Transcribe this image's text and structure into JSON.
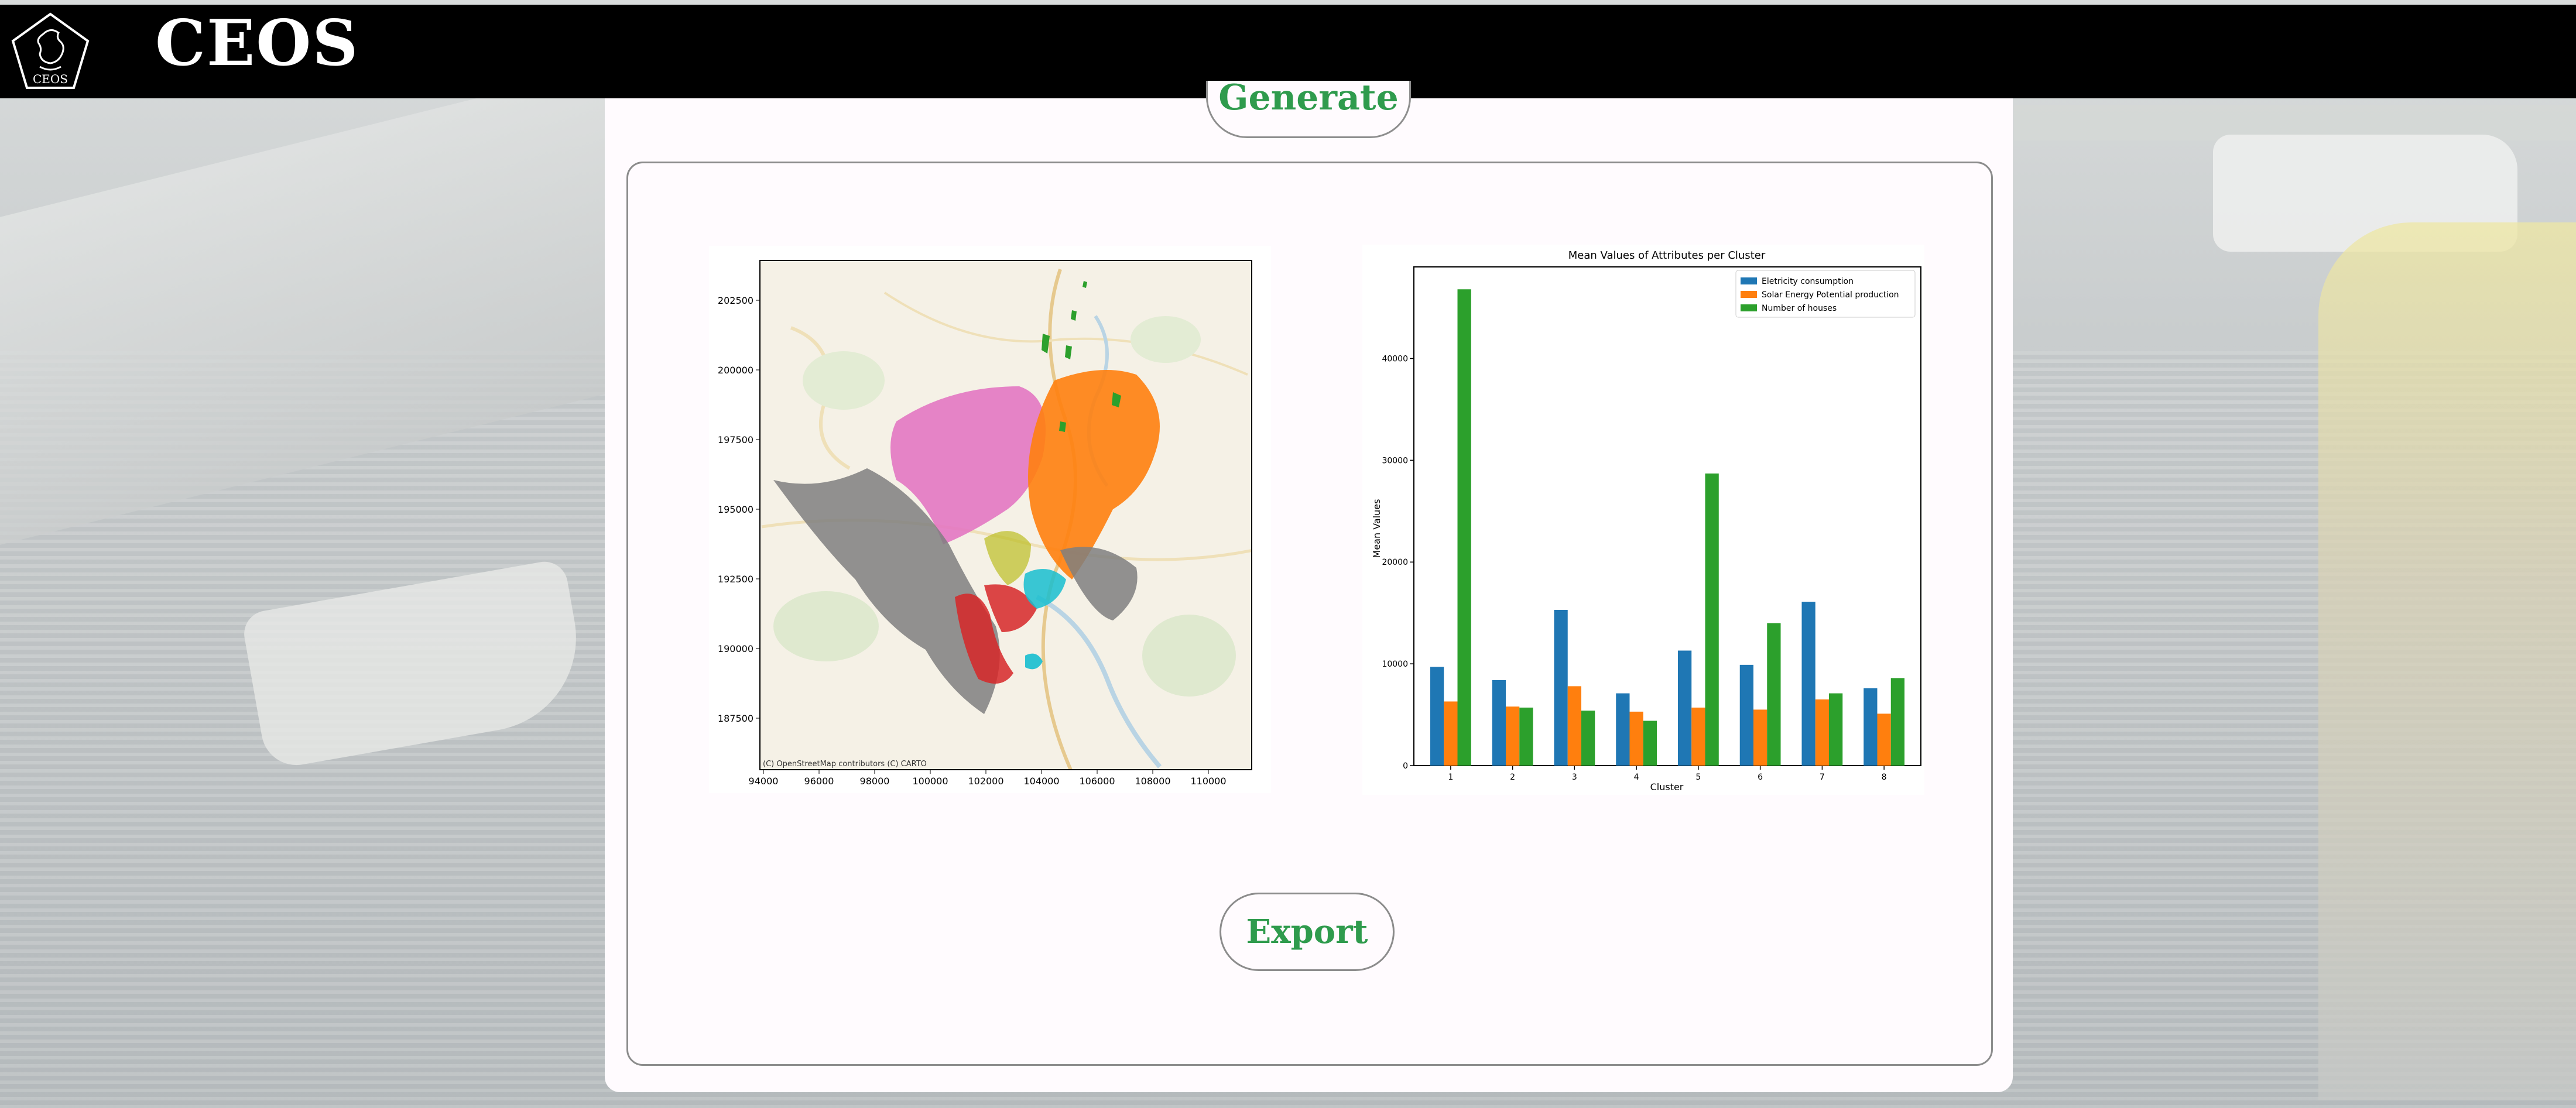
{
  "header": {
    "title": "CEOS",
    "logo_text": "CEOS"
  },
  "buttons": {
    "generate_label": "Generate",
    "export_label": "Export"
  },
  "map": {
    "attribution": "(C) OpenStreetMap contributors (C) CARTO",
    "x_ticks": [
      "94000",
      "96000",
      "98000",
      "100000",
      "102000",
      "104000",
      "106000",
      "108000",
      "110000"
    ],
    "y_ticks": [
      "202500",
      "200000",
      "197500",
      "195000",
      "192500",
      "190000",
      "187500"
    ]
  },
  "colors": {
    "accent": "#2f9b4d",
    "series_blue": "#1f77b4",
    "series_orange": "#ff7f0e",
    "series_green": "#2ca02c",
    "cluster_pink": "#e377c2",
    "cluster_gray": "#7f7f7f",
    "cluster_red": "#d62728",
    "cluster_cyan": "#17becf",
    "cluster_olive": "#bcbd22"
  },
  "chart_data": {
    "type": "bar",
    "title": "Mean Values of Attributes per Cluster",
    "xlabel": "Cluster",
    "ylabel": "Mean Values",
    "categories": [
      "1",
      "2",
      "3",
      "4",
      "5",
      "6",
      "7",
      "8"
    ],
    "series": [
      {
        "name": "Eletricity consumption",
        "values": [
          9700,
          8400,
          15300,
          7100,
          11300,
          9900,
          16100,
          7600
        ]
      },
      {
        "name": "Solar Energy Potential production",
        "values": [
          6300,
          5800,
          7800,
          5300,
          5700,
          5500,
          6500,
          5100
        ]
      },
      {
        "name": "Number of houses",
        "values": [
          46800,
          5700,
          5400,
          4400,
          28700,
          14000,
          7100,
          8600
        ]
      }
    ],
    "ylim": [
      0,
      49000
    ],
    "y_ticks": [
      "0",
      "10000",
      "20000",
      "30000",
      "40000"
    ],
    "legend": "top-right",
    "grid": false
  }
}
